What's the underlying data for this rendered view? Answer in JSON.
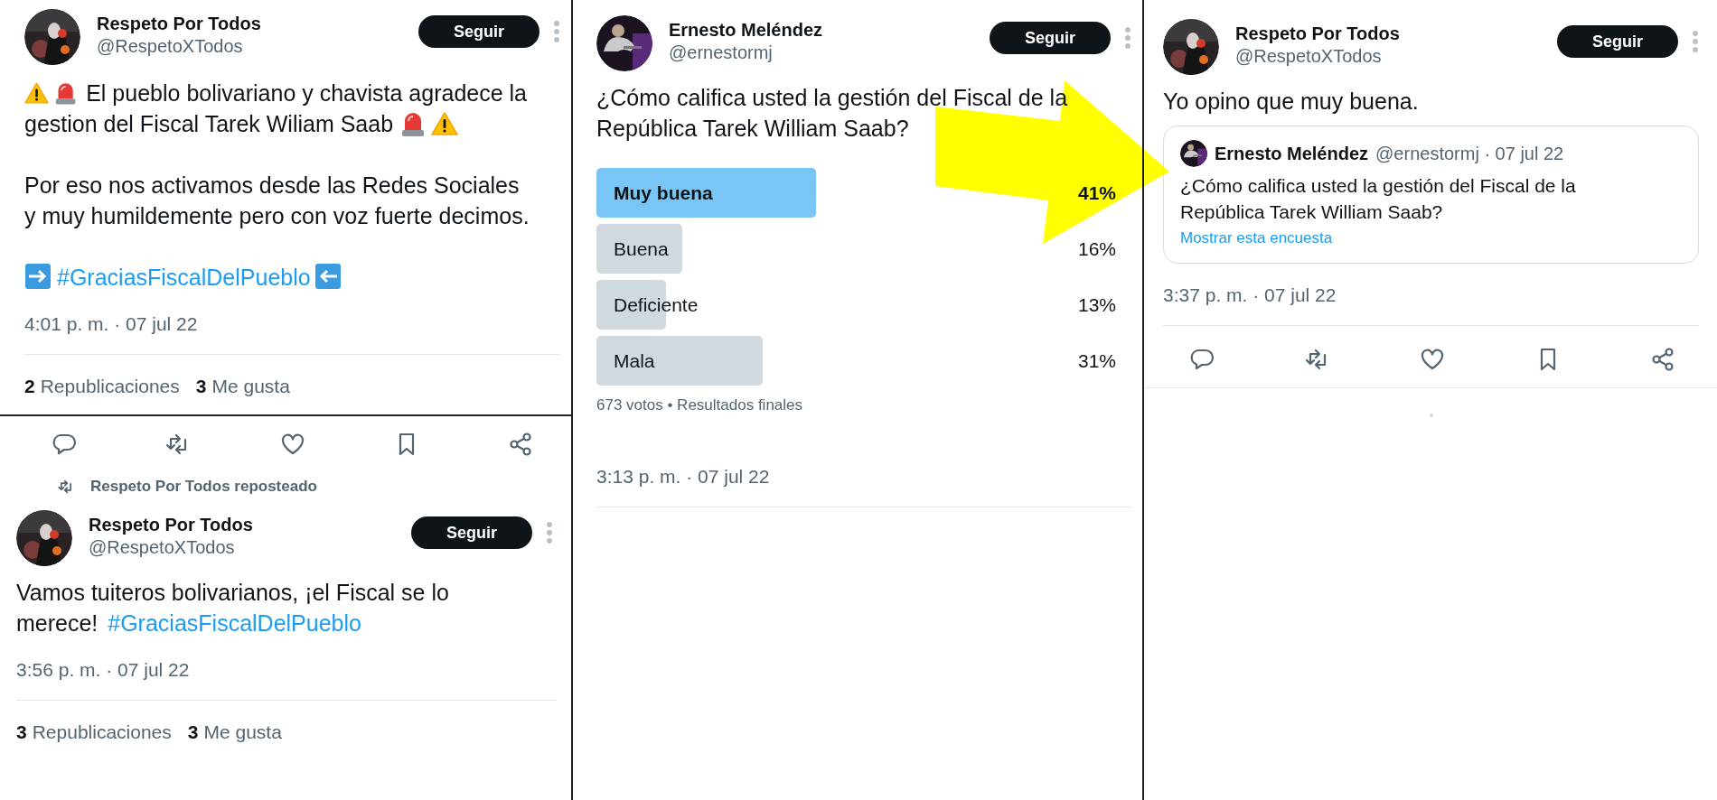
{
  "highlight_arrow": true,
  "columns": [
    {
      "panels": [
        {
          "blocks": [
            {
              "kind": "header",
              "name": "Respeto Por Todos",
              "handle": "@RespetoXTodos",
              "follow": "Seguir"
            },
            {
              "kind": "body",
              "paragraphs": [
                {
                  "kind": "alert",
                  "lines": [
                    "El pueblo bolivariano y chavista agradece la",
                    "gestion del Fiscal Tarek Wiliam Saab"
                  ]
                },
                {
                  "kind": "text",
                  "text": "Por eso nos activamos desde las Redes Sociales y muy humildemente pero con voz fuerte decimos."
                },
                {
                  "kind": "arrows",
                  "hashtag": "#GraciasFiscalDelPueblo"
                }
              ]
            },
            {
              "kind": "time",
              "text": "4:01 p. m. · 07 jul 22"
            },
            {
              "kind": "rule"
            },
            {
              "kind": "stats",
              "items": [
                {
                  "count": "2",
                  "label": "Republicaciones"
                },
                {
                  "count": "3",
                  "label": "Me gusta"
                }
              ]
            }
          ]
        },
        {
          "blocks": [
            {
              "kind": "actions"
            },
            {
              "kind": "repost",
              "text": "Respeto Por Todos reposteado"
            },
            {
              "kind": "header",
              "name": "Respeto Por Todos",
              "handle": "@RespetoXTodos",
              "follow": "Seguir"
            },
            {
              "kind": "body",
              "paragraphs": [
                {
                  "kind": "text",
                  "text": "Vamos tuiteros bolivarianos, ¡el Fiscal se lo merece! ",
                  "hashtag": "#GraciasFiscalDelPueblo"
                }
              ]
            },
            {
              "kind": "time",
              "text": "3:56 p. m. · 07 jul 22"
            },
            {
              "kind": "rule"
            },
            {
              "kind": "stats",
              "items": [
                {
                  "count": "3",
                  "label": "Republicaciones"
                },
                {
                  "count": "3",
                  "label": "Me gusta"
                }
              ]
            }
          ]
        }
      ]
    },
    {
      "panels": [
        {
          "blocks": [
            {
              "kind": "header",
              "name": "Ernesto Meléndez",
              "handle": "@ernestormj",
              "follow": "Seguir"
            },
            {
              "kind": "body",
              "paragraphs": [
                {
                  "kind": "text",
                  "text": "¿Cómo califica usted la gestión del Fiscal de la República Tarek William Saab?"
                }
              ]
            },
            {
              "kind": "poll",
              "options": [
                {
                  "label": "Muy buena",
                  "percent": "41%",
                  "winner": true
                },
                {
                  "label": "Buena",
                  "percent": "16%",
                  "winner": false
                },
                {
                  "label": "Deficiente",
                  "percent": "13%",
                  "winner": false
                },
                {
                  "label": "Mala",
                  "percent": "31%",
                  "winner": false
                }
              ],
              "summary": "673 votos • Resultados finales"
            },
            {
              "kind": "time",
              "text": "3:13 p. m. · 07 jul 22"
            },
            {
              "kind": "rule"
            }
          ]
        }
      ]
    },
    {
      "panels": [
        {
          "blocks": [
            {
              "kind": "header",
              "name": "Respeto Por Todos",
              "handle": "@RespetoXTodos",
              "follow": "Seguir"
            },
            {
              "kind": "body",
              "paragraphs": [
                {
                  "kind": "text",
                  "text": "Yo opino que muy buena."
                }
              ]
            },
            {
              "kind": "quote",
              "name": "Ernesto Meléndez",
              "meta": "@ernestormj · 07 jul 22",
              "text": "¿Cómo califica usted la gestión del Fiscal de la República Tarek William Saab?",
              "link": "Mostrar esta encuesta"
            },
            {
              "kind": "time",
              "text": "3:37 p. m. · 07 jul 22"
            },
            {
              "kind": "rule"
            },
            {
              "kind": "actions"
            },
            {
              "kind": "rule"
            },
            {
              "kind": "loader"
            }
          ]
        }
      ]
    }
  ]
}
